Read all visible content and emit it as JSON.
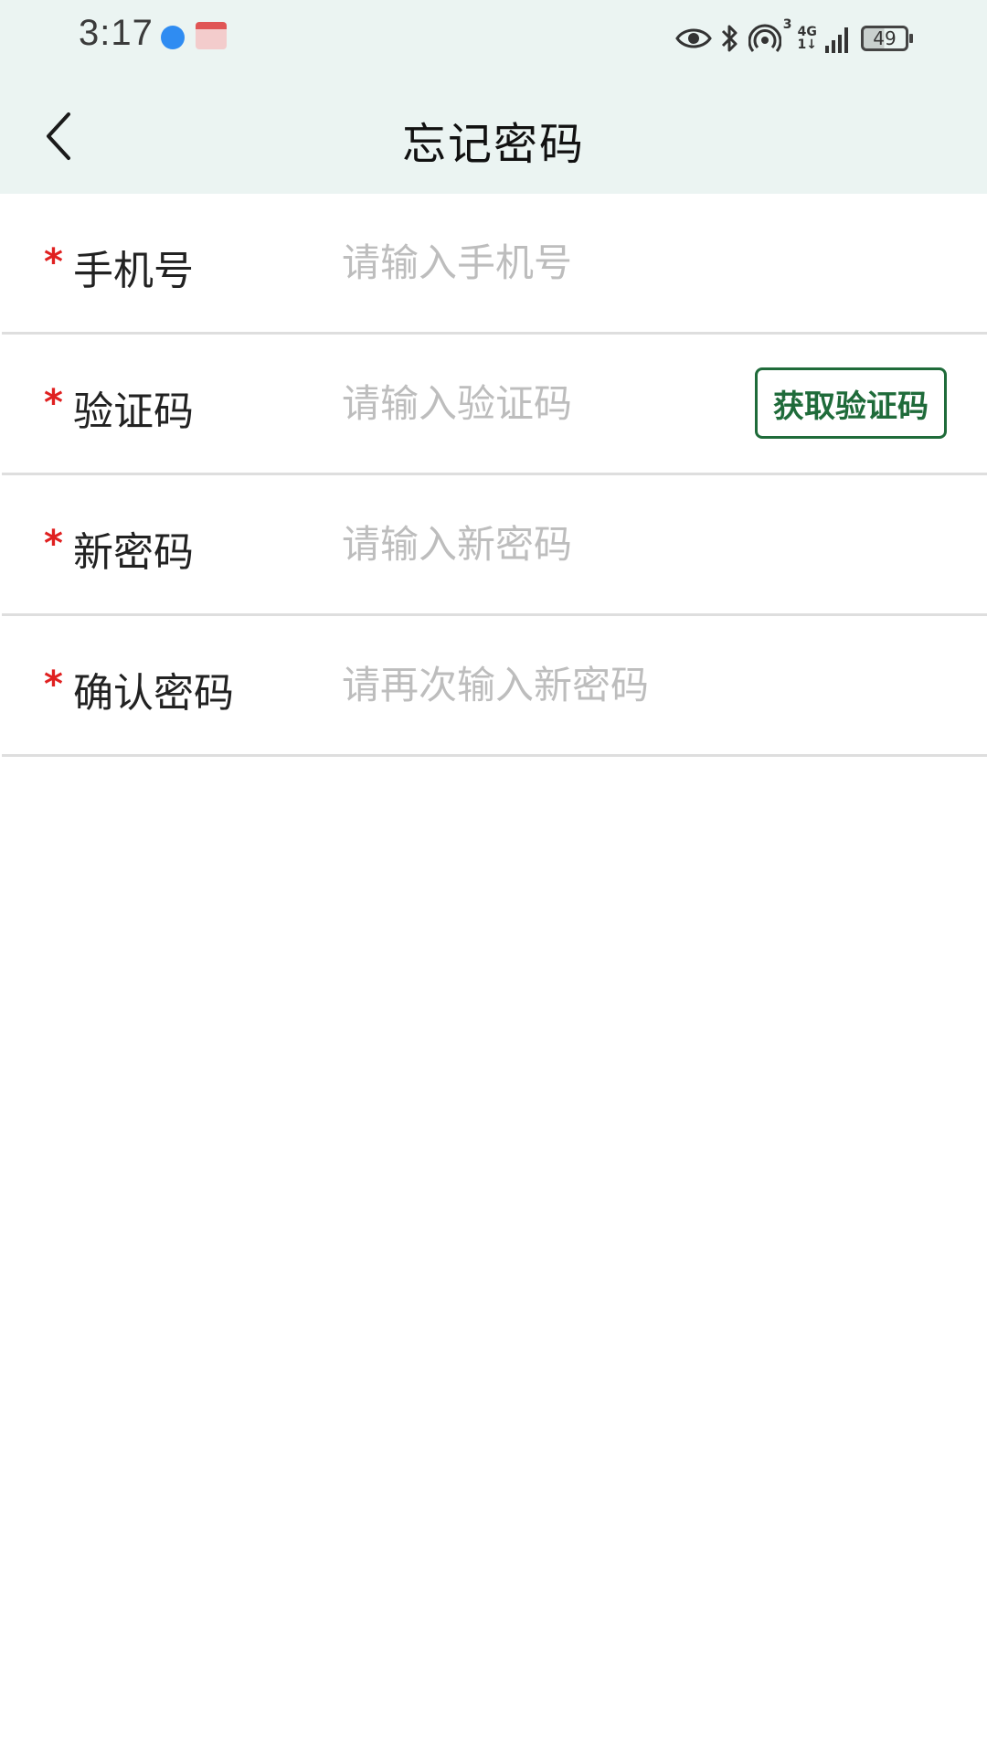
{
  "status_bar": {
    "time": "3:17",
    "network_top": "4G",
    "network_bottom": "1↓",
    "hotspot_count": "3",
    "battery": "49"
  },
  "header": {
    "title": "忘记密码"
  },
  "form": {
    "required_mark": "*",
    "fields": [
      {
        "label": "手机号",
        "placeholder": "请输入手机号",
        "value": ""
      },
      {
        "label": "验证码",
        "placeholder": "请输入验证码",
        "value": "",
        "action_label": "获取验证码"
      },
      {
        "label": "新密码",
        "placeholder": "请输入新密码",
        "value": ""
      },
      {
        "label": "确认密码",
        "placeholder": "请再次输入新密码",
        "value": ""
      }
    ]
  },
  "colors": {
    "header_bg": "#ebf4f2",
    "accent_green": "#1f6b3a",
    "required_red": "#e02020",
    "placeholder_gray": "#bdbdbd",
    "divider": "#dedede"
  },
  "icons": {
    "back": "chevron-left-icon",
    "eye": "eye-icon",
    "bluetooth": "bluetooth-icon",
    "hotspot": "hotspot-icon",
    "signal": "signal-icon",
    "battery": "battery-icon"
  }
}
